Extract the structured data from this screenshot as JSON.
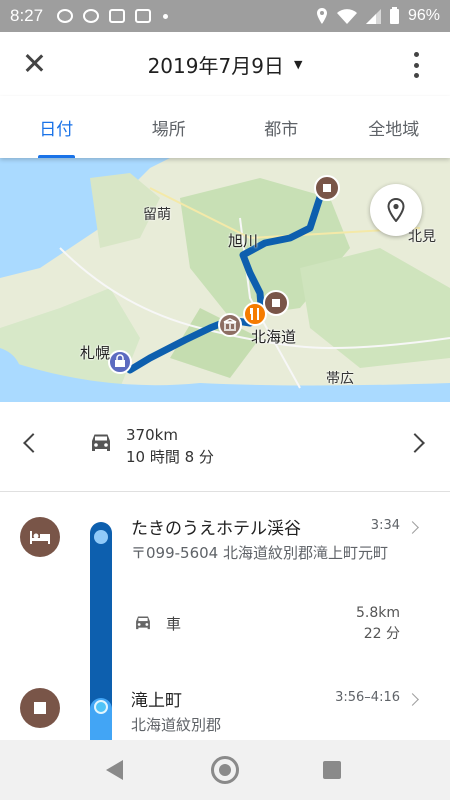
{
  "status_bar": {
    "time": "8:27",
    "battery": "96%",
    "icons": [
      "alarm-icon",
      "shield-icon",
      "news-icon",
      "calendar-icon",
      "location-icon",
      "wifi-icon",
      "signal-icon",
      "battery-icon"
    ]
  },
  "header": {
    "date": "2019年7月9日",
    "caret": "▼"
  },
  "tabs": [
    {
      "label": "日付",
      "active": true
    },
    {
      "label": "場所",
      "active": false
    },
    {
      "label": "都市",
      "active": false
    },
    {
      "label": "全地域",
      "active": false
    }
  ],
  "map": {
    "labels": {
      "rumoi": "留萌",
      "asahikawa": "旭川",
      "kitami": "北見",
      "hokkaido": "北海道",
      "sapporo": "札幌",
      "obihiro": "帯広"
    }
  },
  "summary": {
    "distance": "370km",
    "duration": "10 時間 8 分"
  },
  "timeline": {
    "stop1": {
      "name": "たきのうえホテル渓谷",
      "time": "3:34",
      "address": "〒099-5604 北海道紋別郡滝上町元町"
    },
    "transit": {
      "mode": "車",
      "distance": "5.8km",
      "duration": "22 分"
    },
    "stop2": {
      "name": "滝上町",
      "time": "3:56–4:16",
      "address": "北海道紋別郡"
    }
  },
  "colors": {
    "accent": "#1a73e8",
    "route": "#0d5fae",
    "place_marker": "#795548",
    "food_marker": "#f57c00"
  }
}
